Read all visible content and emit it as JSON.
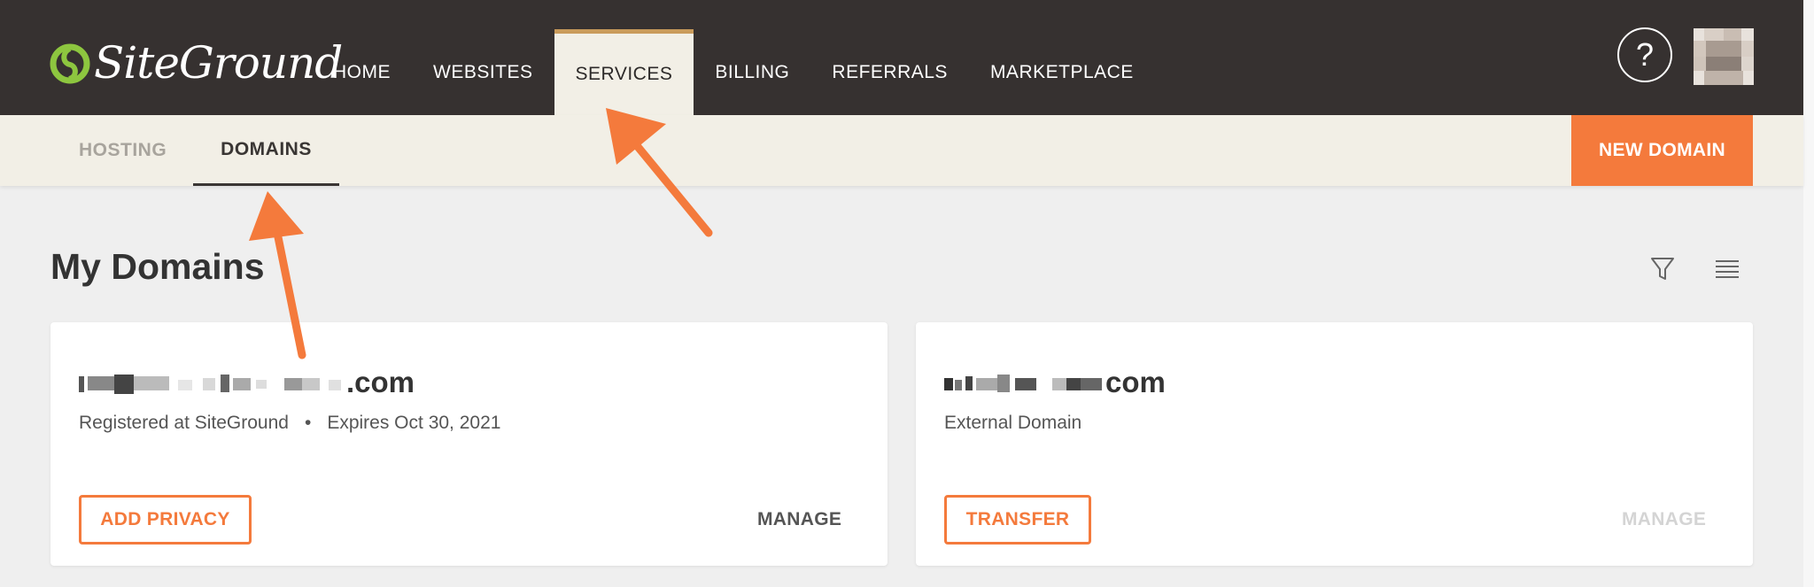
{
  "brand": {
    "name": "SiteGround",
    "accent_color": "#f47a3c",
    "logo_green": "#8dc63f"
  },
  "topnav": {
    "items": [
      {
        "label": "HOME"
      },
      {
        "label": "WEBSITES"
      },
      {
        "label": "SERVICES",
        "active": true
      },
      {
        "label": "BILLING"
      },
      {
        "label": "REFERRALS"
      },
      {
        "label": "MARKETPLACE"
      }
    ],
    "help_label": "?",
    "help_icon": "question-circle-icon",
    "avatar_icon": "user-avatar-pixelated"
  },
  "subnav": {
    "tabs": [
      {
        "label": "HOSTING"
      },
      {
        "label": "DOMAINS",
        "active": true
      }
    ],
    "new_domain_label": "NEW DOMAIN"
  },
  "main": {
    "title": "My Domains",
    "filter_icon": "filter-icon",
    "list_icon": "list-view-icon",
    "domains": [
      {
        "name_suffix": ".com",
        "registrar": "Registered at SiteGround",
        "separator": "•",
        "expires": "Expires Oct 30, 2021",
        "primary_action": "ADD PRIVACY",
        "manage_label": "MANAGE",
        "manage_enabled": true
      },
      {
        "name_suffix": "com",
        "registrar": "External Domain",
        "primary_action": "TRANSFER",
        "manage_label": "MANAGE",
        "manage_enabled": false
      }
    ]
  },
  "annotations": {
    "arrow_color": "#f47a3c",
    "arrow_count": 2
  }
}
